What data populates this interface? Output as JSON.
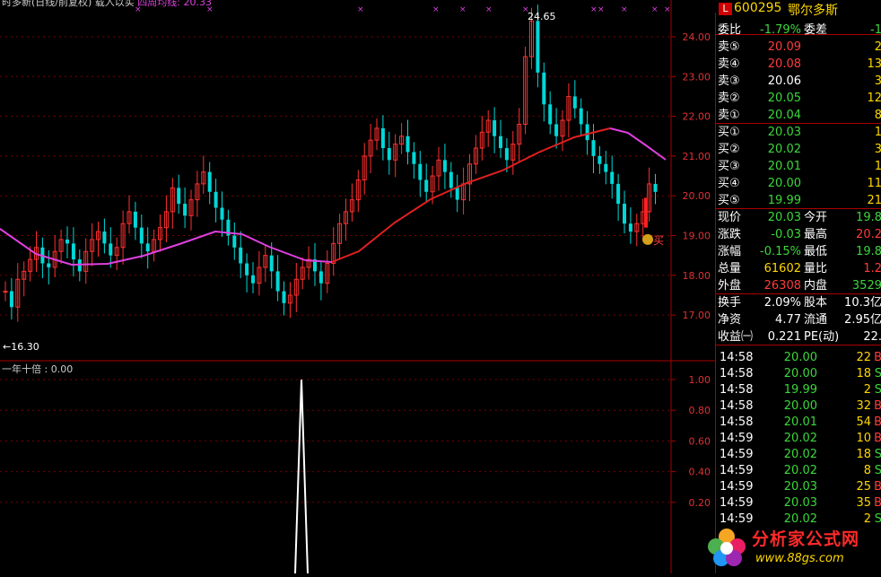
{
  "indicator_title": "时多新(日线/前复权) 载入以实",
  "indicator_label": "四周均线: 20.33",
  "sub_title": "一年十倍 : 0.00",
  "price_axis": [
    "24.00",
    "23.00",
    "22.00",
    "21.00",
    "20.00",
    "19.00",
    "18.00",
    "17.00"
  ],
  "sub_axis": [
    "1.00",
    "0.80",
    "0.60",
    "0.40",
    "0.20"
  ],
  "high_marker": "24.65",
  "low_marker": "←16.30",
  "buy_label": "买",
  "stock": {
    "badge": "L",
    "code": "600295",
    "name": "鄂尔多斯"
  },
  "quote_rows": [
    {
      "l": "委比",
      "v": "-1.79%",
      "vc": "green",
      "l2": "委差",
      "v2": "-1",
      "v2c": "green"
    },
    {
      "l": "卖⑤",
      "v": "20.09",
      "vc": "red",
      "v2": "2",
      "v2c": "yellow"
    },
    {
      "l": "卖④",
      "v": "20.08",
      "vc": "red",
      "v2": "13",
      "v2c": "yellow"
    },
    {
      "l": "卖③",
      "v": "20.06",
      "vc": "white",
      "v2": "3",
      "v2c": "yellow"
    },
    {
      "l": "卖②",
      "v": "20.05",
      "vc": "green",
      "v2": "12",
      "v2c": "yellow"
    },
    {
      "l": "卖①",
      "v": "20.04",
      "vc": "green",
      "v2": "8",
      "v2c": "yellow"
    },
    {
      "l": "买①",
      "v": "20.03",
      "vc": "green",
      "v2": "1",
      "v2c": "yellow"
    },
    {
      "l": "买②",
      "v": "20.02",
      "vc": "green",
      "v2": "3",
      "v2c": "yellow"
    },
    {
      "l": "买③",
      "v": "20.01",
      "vc": "green",
      "v2": "1",
      "v2c": "yellow"
    },
    {
      "l": "买④",
      "v": "20.00",
      "vc": "green",
      "v2": "11",
      "v2c": "yellow"
    },
    {
      "l": "买⑤",
      "v": "19.99",
      "vc": "green",
      "v2": "21",
      "v2c": "yellow"
    },
    {
      "l": "现价",
      "v": "20.03",
      "vc": "green",
      "l2": "今开",
      "v2": "19.8",
      "v2c": "green"
    },
    {
      "l": "涨跌",
      "v": "-0.03",
      "vc": "green",
      "l2": "最高",
      "v2": "20.2",
      "v2c": "red"
    },
    {
      "l": "涨幅",
      "v": "-0.15%",
      "vc": "green",
      "l2": "最低",
      "v2": "19.8",
      "v2c": "green"
    },
    {
      "l": "总量",
      "v": "61602",
      "vc": "yellow",
      "l2": "量比",
      "v2": "1.2",
      "v2c": "red"
    },
    {
      "l": "外盘",
      "v": "26308",
      "vc": "red",
      "l2": "内盘",
      "v2": "3529",
      "v2c": "green"
    },
    {
      "l": "换手",
      "v": "2.09%",
      "vc": "white",
      "l2": "股本",
      "v2": "10.3亿",
      "v2c": "white"
    },
    {
      "l": "净资",
      "v": "4.77",
      "vc": "white",
      "l2": "流通",
      "v2": "2.95亿",
      "v2c": "white"
    },
    {
      "l": "收益㈠",
      "v": "0.221",
      "vc": "white",
      "l2": "PE(动)",
      "v2": "22.",
      "v2c": "white"
    }
  ],
  "ticks": [
    {
      "t": "14:58",
      "p": "20.00",
      "pc": "green",
      "v": "22",
      "f": "B"
    },
    {
      "t": "14:58",
      "p": "20.00",
      "pc": "green",
      "v": "18",
      "f": "S"
    },
    {
      "t": "14:58",
      "p": "19.99",
      "pc": "green",
      "v": "2",
      "f": "S"
    },
    {
      "t": "14:58",
      "p": "20.00",
      "pc": "green",
      "v": "32",
      "f": "B"
    },
    {
      "t": "14:58",
      "p": "20.01",
      "pc": "green",
      "v": "54",
      "f": "B"
    },
    {
      "t": "14:59",
      "p": "20.02",
      "pc": "green",
      "v": "10",
      "f": "B"
    },
    {
      "t": "14:59",
      "p": "20.02",
      "pc": "green",
      "v": "18",
      "f": "S"
    },
    {
      "t": "14:59",
      "p": "20.02",
      "pc": "green",
      "v": "8",
      "f": "S"
    },
    {
      "t": "14:59",
      "p": "20.03",
      "pc": "green",
      "v": "25",
      "f": "B"
    },
    {
      "t": "14:59",
      "p": "20.03",
      "pc": "green",
      "v": "35",
      "f": "B"
    },
    {
      "t": "14:59",
      "p": "20.02",
      "pc": "green",
      "v": "2",
      "f": "S"
    }
  ],
  "watermark": {
    "title": "分析家公式网",
    "url": "www.88gs.com"
  }
}
